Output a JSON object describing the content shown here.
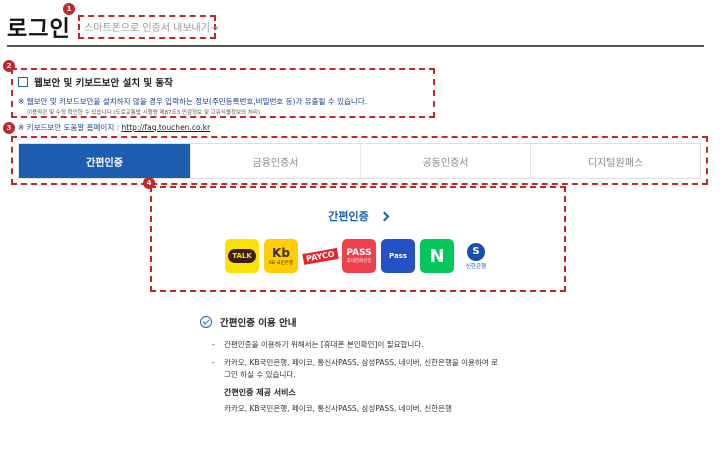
{
  "header": {
    "title": "로그인",
    "export_link": "스마트폰으로 인증서 내보내기→"
  },
  "badges": [
    "1",
    "2",
    "3",
    "4"
  ],
  "security": {
    "checkbox_label": "웹보안 및 키보드보안 설치 및 동작",
    "warning": "※ 웹보안 및 키보드보안을 설치하지 않을 경우 입력하는 정보(주민등록번호,비밀번호 등)가 유출될 수 있습니다.",
    "note": "이용약관 및 수정 확인한 수 있습니다 (도로교통법 시행령 제87조3 민감정보 및 고유식별정보의 처리)",
    "helpdesk_label": "※ 키보드보안 도움말 홈페이지 :",
    "helpdesk_url": "http://faq.touchen.co.kr"
  },
  "tabs": [
    {
      "label": "간편인증",
      "active": true
    },
    {
      "label": "금융인증서",
      "active": false
    },
    {
      "label": "공동인증서",
      "active": false
    },
    {
      "label": "디지털원패스",
      "active": false
    }
  ],
  "panel": {
    "title": "간편인증",
    "providers": {
      "kakao": "TALK",
      "kb": "Kb",
      "kb_sub": "KB 국민은행",
      "payco": "PAYCO",
      "pass": "PASS",
      "pass_sub": "휴대전화인증",
      "samsung_pass": "Pass",
      "naver": "N",
      "shinhan": "S",
      "shinhan_sub": "신한은행"
    }
  },
  "guide": {
    "title": "간편인증 이용 안내",
    "dash": "-",
    "items": [
      "간편인증을 이용하기 위해서는 [휴대폰 본인확인]이 필요합니다.",
      "카카오, KB국민은행, 페이코, 통신사PASS, 삼성PASS, 네이버, 신한은행을 이용하여 로그인 하실 수 있습니다."
    ],
    "services_title": "간편인증 제공 서비스",
    "services_text": "카카오, KB국민은행, 페이코, 통신사PASS, 삼성PASS, 네이버, 신한은행"
  },
  "colors": {
    "accent": "#1c5fb1",
    "annotation": "#c0282d"
  }
}
